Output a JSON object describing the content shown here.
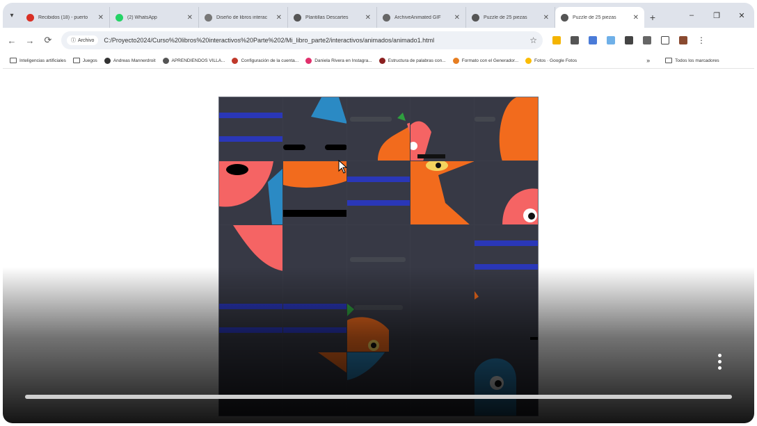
{
  "browser": {
    "tabs": [
      {
        "title": "Recibidos (18) - puerto",
        "color": "#d93025"
      },
      {
        "title": "(2) WhatsApp",
        "color": "#25d366"
      },
      {
        "title": "Diseño de libros interac",
        "color": "#777777"
      },
      {
        "title": "Plantillas Descartes",
        "color": "#555555"
      },
      {
        "title": "ArchiveAnimated GIF",
        "color": "#666666"
      },
      {
        "title": "Puzzle de 25 piezas",
        "color": "#555555"
      },
      {
        "title": "Puzzle de 25 piezas",
        "color": "#555555",
        "active": true
      }
    ],
    "new_tab": "+",
    "window_controls": [
      "–",
      "❐",
      "✕"
    ],
    "chip_label": "Archivo",
    "url": "C:/Proyecto2024/Curso%20libros%20interactivos%20Parte%202/Mi_libro_parte2/interactivos/animados/animado1.html",
    "bookmarks": [
      {
        "label": "Inteligencias artificiales",
        "kind": "folder"
      },
      {
        "label": "Juegos",
        "kind": "folder"
      },
      {
        "label": "Andreas Mannerdroit",
        "kind": "site",
        "color": "#333333"
      },
      {
        "label": "APRENDIENDOS VILLA...",
        "kind": "site",
        "color": "#555555"
      },
      {
        "label": "Configuración de la cuenta...",
        "kind": "site",
        "color": "#c0392b"
      },
      {
        "label": "Daniela Rivera en Instagra...",
        "kind": "site",
        "color": "#e1306c"
      },
      {
        "label": "Estructura de palabras con...",
        "kind": "site",
        "color": "#8b2020"
      },
      {
        "label": "Formato con el Generador...",
        "kind": "site",
        "color": "#e67e22"
      },
      {
        "label": "Fotos · Google Fotos",
        "kind": "site",
        "color": "#fbbc05"
      }
    ],
    "bookmarks_more": "»",
    "all_bookmarks": "Todos los marcadores"
  },
  "video": {
    "progress": 1.0
  },
  "colors": {
    "puzzle_bg": "#373945",
    "stripe": "#2a37b8",
    "orange": "#f26b1d",
    "pink": "#f56464",
    "blue": "#2b8ac4",
    "green": "#2e9e3e"
  }
}
